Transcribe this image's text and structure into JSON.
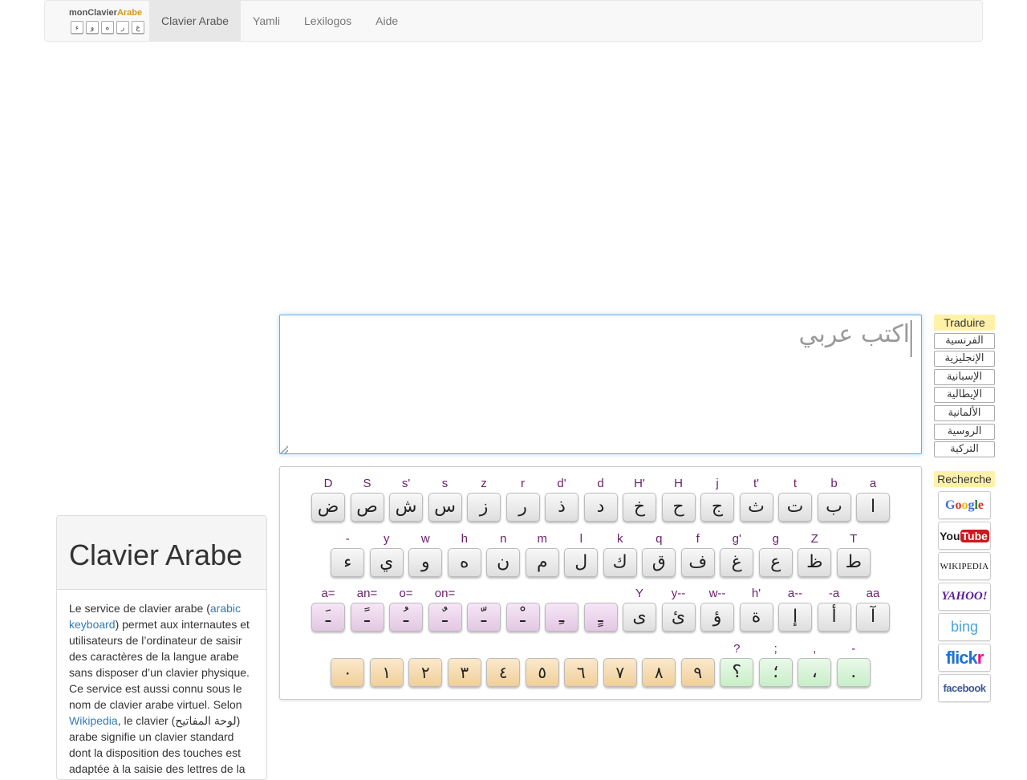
{
  "navbar": {
    "brand": {
      "part1": "mon",
      "part2": "Clavier",
      "part3": "Arabe",
      "keys": [
        "ء",
        "و",
        "ه",
        "ر",
        "ع"
      ]
    },
    "items": [
      {
        "label": "Clavier Arabe",
        "active": true
      },
      {
        "label": "Yamli",
        "active": false
      },
      {
        "label": "Lexilogos",
        "active": false
      },
      {
        "label": "Aide",
        "active": false
      }
    ]
  },
  "editor": {
    "placeholder": "اكتب عربي"
  },
  "keyboard": {
    "rows": [
      {
        "keys": [
          {
            "label": "D",
            "char": "ض",
            "color": "gray"
          },
          {
            "label": "S",
            "char": "ص",
            "color": "gray"
          },
          {
            "label": "s'",
            "char": "ش",
            "color": "gray"
          },
          {
            "label": "s",
            "char": "س",
            "color": "gray"
          },
          {
            "label": "z",
            "char": "ز",
            "color": "gray"
          },
          {
            "label": "r",
            "char": "ر",
            "color": "gray"
          },
          {
            "label": "d'",
            "char": "ذ",
            "color": "gray"
          },
          {
            "label": "d",
            "char": "د",
            "color": "gray"
          },
          {
            "label": "H'",
            "char": "خ",
            "color": "gray"
          },
          {
            "label": "H",
            "char": "ح",
            "color": "gray"
          },
          {
            "label": "j",
            "char": "ج",
            "color": "gray"
          },
          {
            "label": "t'",
            "char": "ث",
            "color": "gray"
          },
          {
            "label": "t",
            "char": "ت",
            "color": "gray"
          },
          {
            "label": "b",
            "char": "ب",
            "color": "gray"
          },
          {
            "label": "a",
            "char": "ا",
            "color": "gray"
          }
        ]
      },
      {
        "keys": [
          {
            "label": "-",
            "char": "ء",
            "color": "gray"
          },
          {
            "label": "y",
            "char": "ي",
            "color": "gray"
          },
          {
            "label": "w",
            "char": "و",
            "color": "gray"
          },
          {
            "label": "h",
            "char": "ه",
            "color": "gray"
          },
          {
            "label": "n",
            "char": "ن",
            "color": "gray"
          },
          {
            "label": "m",
            "char": "م",
            "color": "gray"
          },
          {
            "label": "l",
            "char": "ل",
            "color": "gray"
          },
          {
            "label": "k",
            "char": "ك",
            "color": "gray"
          },
          {
            "label": "q",
            "char": "ق",
            "color": "gray"
          },
          {
            "label": "f",
            "char": "ف",
            "color": "gray"
          },
          {
            "label": "g'",
            "char": "غ",
            "color": "gray"
          },
          {
            "label": "g",
            "char": "ع",
            "color": "gray"
          },
          {
            "label": "Z",
            "char": "ظ",
            "color": "gray"
          },
          {
            "label": "T",
            "char": "ط",
            "color": "gray"
          }
        ]
      },
      {
        "keys": [
          {
            "label": "a=",
            "char": "ـَ",
            "color": "pink"
          },
          {
            "label": "an=",
            "char": "ـً",
            "color": "pink"
          },
          {
            "label": "o=",
            "char": "ـُ",
            "color": "pink"
          },
          {
            "label": "on=",
            "char": "ـٌ",
            "color": "pink"
          },
          {
            "label": "",
            "char": "ـّ",
            "color": "pink"
          },
          {
            "label": "",
            "char": "ـْ",
            "color": "pink"
          },
          {
            "label": "",
            "char": "ـِ",
            "color": "pink"
          },
          {
            "label": "",
            "char": "ـٍ",
            "color": "pink"
          },
          {
            "label": "Y",
            "char": "ى",
            "color": "gray"
          },
          {
            "label": "y--",
            "char": "ئ",
            "color": "gray"
          },
          {
            "label": "w--",
            "char": "ؤ",
            "color": "gray"
          },
          {
            "label": "h'",
            "char": "ة",
            "color": "gray"
          },
          {
            "label": "a--",
            "char": "إ",
            "color": "gray"
          },
          {
            "label": "-a",
            "char": "أ",
            "color": "gray"
          },
          {
            "label": "aa",
            "char": "آ",
            "color": "gray"
          }
        ]
      },
      {
        "keys": [
          {
            "label": "",
            "char": "٠",
            "color": "orange"
          },
          {
            "label": "",
            "char": "١",
            "color": "orange"
          },
          {
            "label": "",
            "char": "٢",
            "color": "orange"
          },
          {
            "label": "",
            "char": "٣",
            "color": "orange"
          },
          {
            "label": "",
            "char": "٤",
            "color": "orange"
          },
          {
            "label": "",
            "char": "٥",
            "color": "orange"
          },
          {
            "label": "",
            "char": "٦",
            "color": "orange"
          },
          {
            "label": "",
            "char": "٧",
            "color": "orange"
          },
          {
            "label": "",
            "char": "٨",
            "color": "orange"
          },
          {
            "label": "",
            "char": "٩",
            "color": "orange"
          },
          {
            "label": "?",
            "char": "؟",
            "color": "green"
          },
          {
            "label": ";",
            "char": "؛",
            "color": "green"
          },
          {
            "label": ",",
            "char": "،",
            "color": "green"
          },
          {
            "label": "-",
            "char": ".",
            "color": "green"
          }
        ]
      }
    ]
  },
  "translate": {
    "heading": "Traduire",
    "languages": [
      "الفرنسية",
      "الإنجليزية",
      "الإسبانية",
      "الإيطالية",
      "الألمانية",
      "الروسية",
      "التركية"
    ]
  },
  "search": {
    "heading": "Recherche",
    "engines": [
      {
        "name": "Google",
        "icon": "google-logo-icon"
      },
      {
        "name": "YouTube",
        "icon": "youtube-logo-icon"
      },
      {
        "name": "WIKIPEDIA",
        "icon": "wikipedia-logo-icon"
      },
      {
        "name": "YAHOO!",
        "icon": "yahoo-logo-icon"
      },
      {
        "name": "bing",
        "icon": "bing-logo-icon"
      },
      {
        "name": "flickr",
        "icon": "flickr-logo-icon"
      },
      {
        "name": "facebook",
        "icon": "facebook-logo-icon"
      }
    ]
  },
  "panel": {
    "title": "Clavier Arabe",
    "text1": "Le service de clavier arabe (",
    "link1": "arabic keyboard",
    "text2": ") permet aux internautes et utilisateurs de l’ordinateur de saisir des caractères de la langue arabe sans disposer d’un clavier physique. Ce service est aussi connu sous le nom de clavier arabe virtuel. Selon ",
    "link2": "Wikipedia",
    "text3": ", le clavier (لوحة المفاتيح) arabe signifie un clavier standard dont la disposition des touches est adaptée à la saisie des lettres de la"
  },
  "colors": {
    "label": "#6b1e6b",
    "highlight": "#fff2a8",
    "link": "#337ab7",
    "focus": "#66afe9"
  }
}
